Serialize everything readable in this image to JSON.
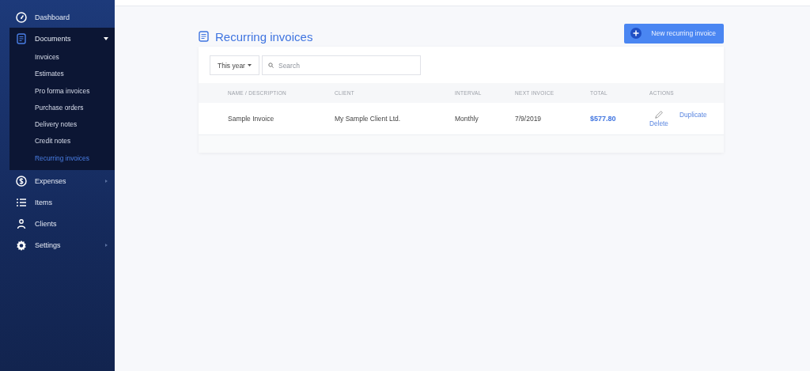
{
  "sidebar": {
    "items": [
      {
        "label": "Dashboard"
      },
      {
        "label": "Documents",
        "expanded": true,
        "children": [
          {
            "label": "Invoices",
            "selected": false
          },
          {
            "label": "Estimates",
            "selected": false
          },
          {
            "label": "Pro forma invoices",
            "selected": false
          },
          {
            "label": "Purchase orders",
            "selected": false
          },
          {
            "label": "Delivery notes",
            "selected": false
          },
          {
            "label": "Credit notes",
            "selected": false
          },
          {
            "label": "Recurring invoices",
            "selected": true
          }
        ]
      },
      {
        "label": "Expenses",
        "expanded": false
      },
      {
        "label": "Items"
      },
      {
        "label": "Clients"
      },
      {
        "label": "Settings",
        "expanded": false
      }
    ]
  },
  "page": {
    "title": "Recurring invoices",
    "new_button": "New recurring invoice"
  },
  "filters": {
    "period": "This year",
    "search": {
      "placeholder": "Search"
    }
  },
  "table": {
    "columns": [
      "NAME / DESCRIPTION",
      "CLIENT",
      "INTERVAL",
      "NEXT INVOICE",
      "TOTAL",
      "ACTIONS"
    ],
    "rows": [
      {
        "name": "Sample Invoice",
        "client": "My Sample Client Ltd.",
        "interval": "Monthly",
        "next_invoice": "7/9/2019",
        "total": "$577.80",
        "actions": [
          "Duplicate",
          "Delete"
        ]
      }
    ]
  }
}
